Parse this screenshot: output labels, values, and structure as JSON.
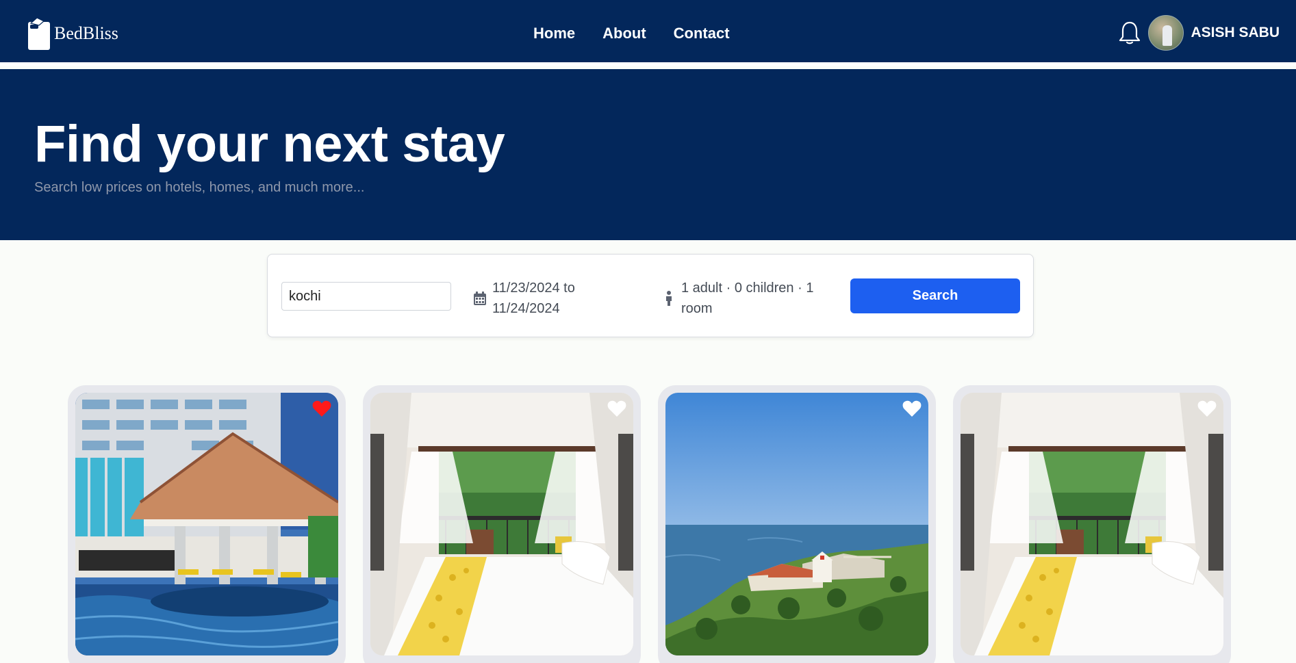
{
  "brand": {
    "name": "BedBliss",
    "logo_icon": "bed-logo-icon"
  },
  "nav": {
    "links": [
      "Home",
      "About",
      "Contact"
    ]
  },
  "user": {
    "name": "ASISH SABU",
    "notification_icon": "bell-icon"
  },
  "hero": {
    "title": "Find your next stay",
    "subtitle": "Search low prices on hotels, homes, and much more..."
  },
  "search": {
    "destination_value": "kochi",
    "dates": "11/23/2024 to 11/24/2024",
    "guests": "1 adult · 0 children · 1 room",
    "button_label": "Search"
  },
  "cards": [
    {
      "scene": "hotel-pool-gazebo",
      "favorited": true
    },
    {
      "scene": "canopy-bedroom",
      "favorited": false
    },
    {
      "scene": "coastal-fort",
      "favorited": false
    },
    {
      "scene": "canopy-bedroom",
      "favorited": false
    }
  ],
  "colors": {
    "navy": "#03275b",
    "accent_blue": "#1d5ff0",
    "heart_red": "#ff1a1a",
    "page_bg": "#fafcf9"
  }
}
